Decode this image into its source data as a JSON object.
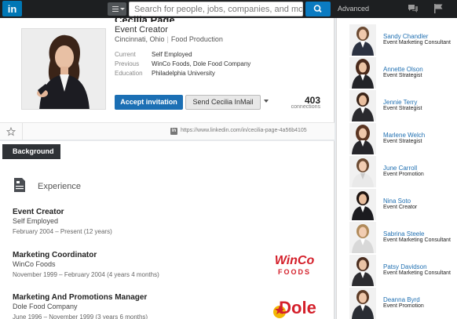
{
  "topbar": {
    "logo_text": "in",
    "search_placeholder": "Search for people, jobs, companies, and more...",
    "advanced_label": "Advanced"
  },
  "profile": {
    "name": "Cecilia Page",
    "headline": "Event Creator",
    "location": "Cincinnati, Ohio",
    "industry": "Food Production",
    "facts": [
      {
        "key": "Current",
        "value": "Self Employed"
      },
      {
        "key": "Previous",
        "value": "WinCo Foods, Dole Food Company"
      },
      {
        "key": "Education",
        "value": "Philadelphia University"
      }
    ],
    "accept_label": "Accept invitation",
    "send_label": "Send Cecilia InMail",
    "connections_count": "403",
    "connections_label": "connections",
    "url": "https://www.linkedin.com/in/cecilia-page-4a56b4105"
  },
  "background": {
    "tab_label": "Background",
    "section_title": "Experience",
    "jobs": [
      {
        "title": "Event Creator",
        "company": "Self Employed",
        "dates": "February 2004 – Present (12 years)"
      },
      {
        "title": "Marketing Coordinator",
        "company": "WinCo Foods",
        "dates": "November 1999 – February 2004 (4 years 4 months)"
      },
      {
        "title": "Marketing And Promotions Manager",
        "company": "Dole Food Company",
        "dates": "June 1996 – November 1999 (3 years 6 months)"
      }
    ],
    "logos": {
      "winco_top": "WinCo",
      "winco_bottom": "FOODS",
      "dole": "Dole"
    }
  },
  "sidebar": {
    "people": [
      {
        "name": "Sandy Chandler",
        "title": "Event Marketing Consultant"
      },
      {
        "name": "Annette Olson",
        "title": "Event Strategist"
      },
      {
        "name": "Jennie Terry",
        "title": "Event Strategist"
      },
      {
        "name": "Marlene Welch",
        "title": "Event Strategist"
      },
      {
        "name": "June Carroll",
        "title": "Event Promotion"
      },
      {
        "name": "Nina Soto",
        "title": "Event Creator"
      },
      {
        "name": "Sabrina Steele",
        "title": "Event Marketing Consultant"
      },
      {
        "name": "Patsy Davidson",
        "title": "Event Marketing Consultant"
      },
      {
        "name": "Deanna Byrd",
        "title": "Event Promotion"
      }
    ]
  },
  "colors": {
    "brand_blue": "#0077b5",
    "link_blue": "#1f6fb1",
    "topbar": "#1d1f21",
    "winco_red": "#d4202b"
  }
}
